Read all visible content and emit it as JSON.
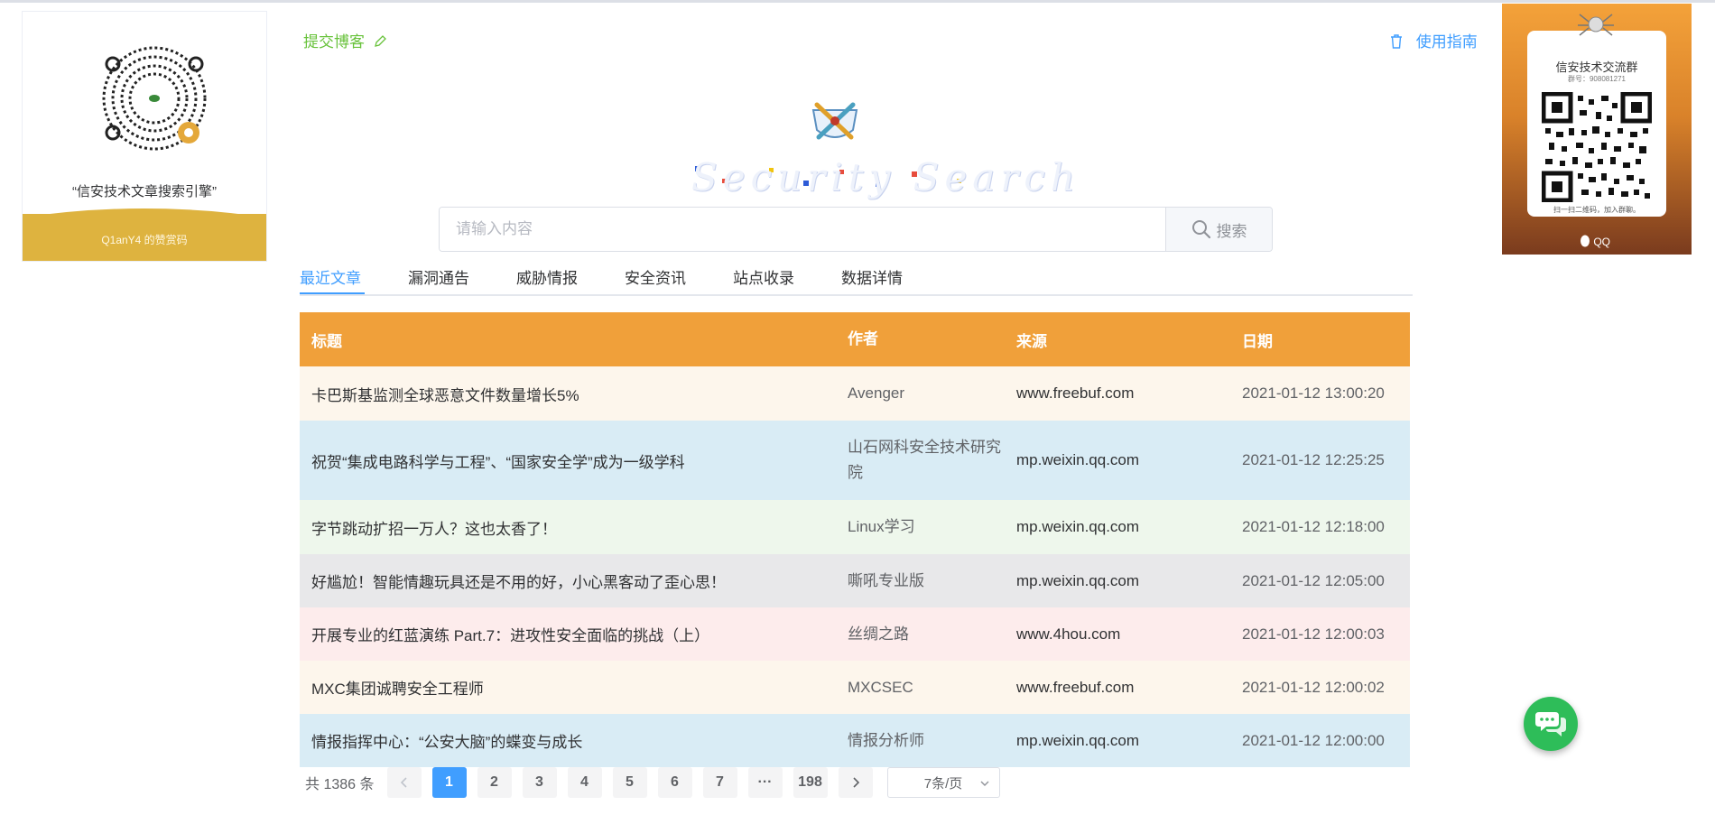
{
  "donate": {
    "caption": "“信安技术文章搜索引擎”",
    "band_text": "Q1anY4 的赞赏码"
  },
  "qq_card": {
    "title": "信安技术交流群",
    "group_number": "群号：908081271",
    "hint": "扫一扫二维码，加入群聊。",
    "brand": "QQ"
  },
  "header": {
    "submit_label": "提交博客",
    "guide_label": "使用指南",
    "logo_text": "Security Search"
  },
  "search": {
    "placeholder": "请输入内容",
    "button_label": "搜索"
  },
  "tabs": [
    {
      "label": "最近文章",
      "active": true
    },
    {
      "label": "漏洞通告"
    },
    {
      "label": "威胁情报"
    },
    {
      "label": "安全资讯"
    },
    {
      "label": "站点收录"
    },
    {
      "label": "数据详情"
    }
  ],
  "table": {
    "headers": [
      "标题",
      "作者",
      "来源",
      "日期"
    ],
    "rows": [
      {
        "title": "卡巴斯基监测全球恶意文件数量增长5%",
        "author": "Avenger",
        "source": "www.freebuf.com",
        "date": "2021-01-12 13:00:20"
      },
      {
        "title": "祝贺“集成电路科学与工程”、“国家安全学”成为一级学科",
        "author": "山石网科安全技术研究院",
        "source": "mp.weixin.qq.com",
        "date": "2021-01-12 12:25:25"
      },
      {
        "title": "字节跳动扩招一万人？这也太香了！",
        "author": "Linux学习",
        "source": "mp.weixin.qq.com",
        "date": "2021-01-12 12:18:00"
      },
      {
        "title": "好尴尬！智能情趣玩具还是不用的好，小心黑客动了歪心思！",
        "author": "嘶吼专业版",
        "source": "mp.weixin.qq.com",
        "date": "2021-01-12 12:05:00"
      },
      {
        "title": "开展专业的红蓝演练 Part.7：进攻性安全面临的挑战（上）",
        "author": "丝绸之路",
        "source": "www.4hou.com",
        "date": "2021-01-12 12:00:03"
      },
      {
        "title": "MXC集团诚聘安全工程师",
        "author": "MXCSEC",
        "source": "www.freebuf.com",
        "date": "2021-01-12 12:00:02"
      },
      {
        "title": "情报指挥中心：“公安大脑”的蝶变与成长",
        "author": "情报分析师",
        "source": "mp.weixin.qq.com",
        "date": "2021-01-12 12:00:00"
      }
    ],
    "row_colors": [
      "#fdf6ec",
      "#d9ecf5",
      "#eef7ec",
      "#e8e8ea",
      "#fdecec",
      "#fdf6ec",
      "#d9ecf5"
    ],
    "header_color": "#f0a03a"
  },
  "pagination": {
    "total": "共 1386 条",
    "pages": [
      "1",
      "2",
      "3",
      "4",
      "5",
      "6",
      "7",
      "···",
      "198"
    ],
    "current": "1",
    "page_size": "7条/页"
  }
}
